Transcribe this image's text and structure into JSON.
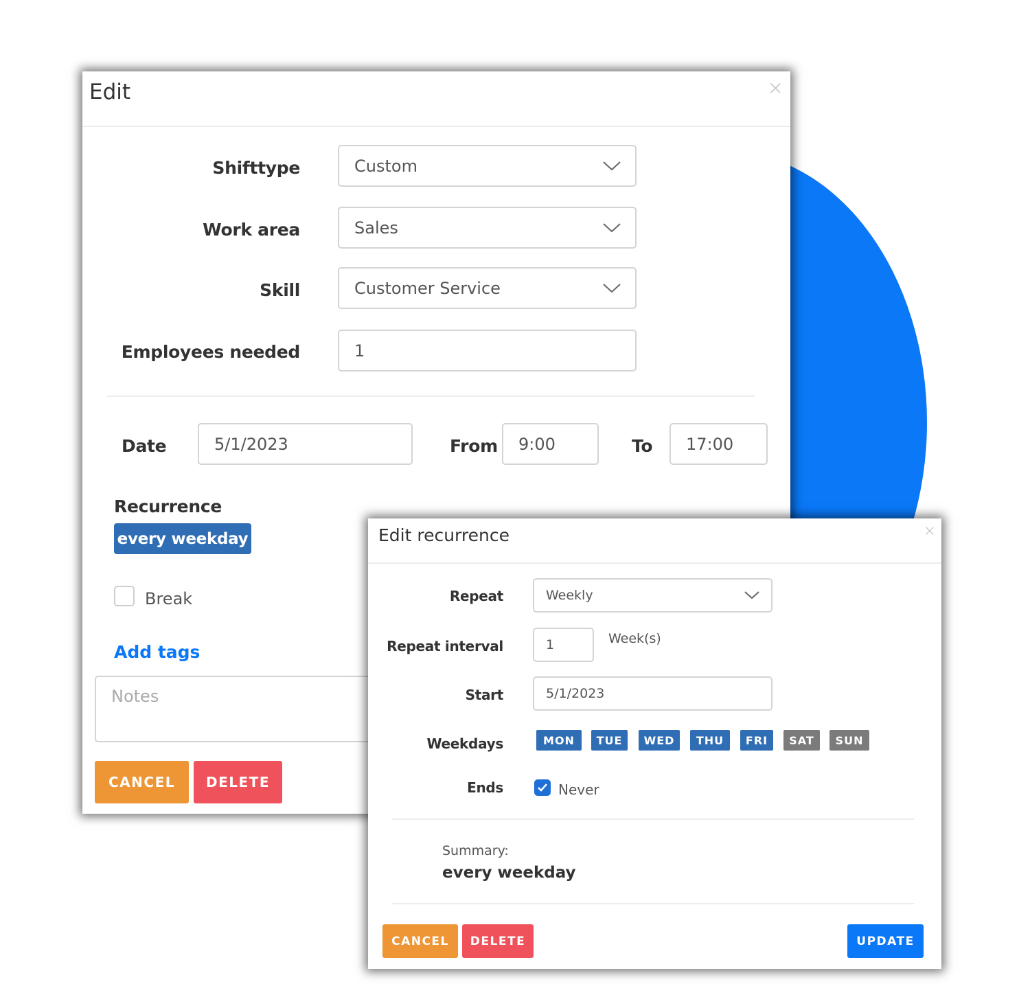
{
  "colors": {
    "accent": "#0a78f7",
    "chip": "#2f6db4",
    "cancel": "#ee9535",
    "delete": "#ef525a",
    "day_inactive": "#7b7b7b"
  },
  "edit_dialog": {
    "title": "Edit",
    "close_icon": "×",
    "fields": {
      "shifttype": {
        "label": "Shifttype",
        "value": "Custom"
      },
      "work_area": {
        "label": "Work area",
        "value": "Sales"
      },
      "skill": {
        "label": "Skill",
        "value": "Customer Service"
      },
      "employees_needed": {
        "label": "Employees needed",
        "value": "1"
      }
    },
    "date": {
      "label": "Date",
      "value": "5/1/2023"
    },
    "from": {
      "label": "From",
      "value": "9:00"
    },
    "to": {
      "label": "To",
      "value": "17:00"
    },
    "recurrence": {
      "label": "Recurrence",
      "chip": "every weekday"
    },
    "break": {
      "label": "Break",
      "checked": false
    },
    "add_tags": "Add tags",
    "notes_placeholder": "Notes",
    "buttons": {
      "cancel": "CANCEL",
      "delete": "DELETE"
    }
  },
  "recurrence_dialog": {
    "title": "Edit recurrence",
    "close_icon": "×",
    "repeat": {
      "label": "Repeat",
      "value": "Weekly"
    },
    "repeat_interval": {
      "label": "Repeat interval",
      "value": "1",
      "unit": "Week(s)"
    },
    "start": {
      "label": "Start",
      "value": "5/1/2023"
    },
    "weekdays": {
      "label": "Weekdays",
      "days": [
        {
          "label": "MON",
          "active": true
        },
        {
          "label": "TUE",
          "active": true
        },
        {
          "label": "WED",
          "active": true
        },
        {
          "label": "THU",
          "active": true
        },
        {
          "label": "FRI",
          "active": true
        },
        {
          "label": "SAT",
          "active": false
        },
        {
          "label": "SUN",
          "active": false
        }
      ]
    },
    "ends": {
      "label": "Ends",
      "option": "Never",
      "checked": true
    },
    "summary": {
      "label": "Summary:",
      "value": "every weekday"
    },
    "buttons": {
      "cancel": "CANCEL",
      "delete": "DELETE",
      "update": "UPDATE"
    }
  }
}
